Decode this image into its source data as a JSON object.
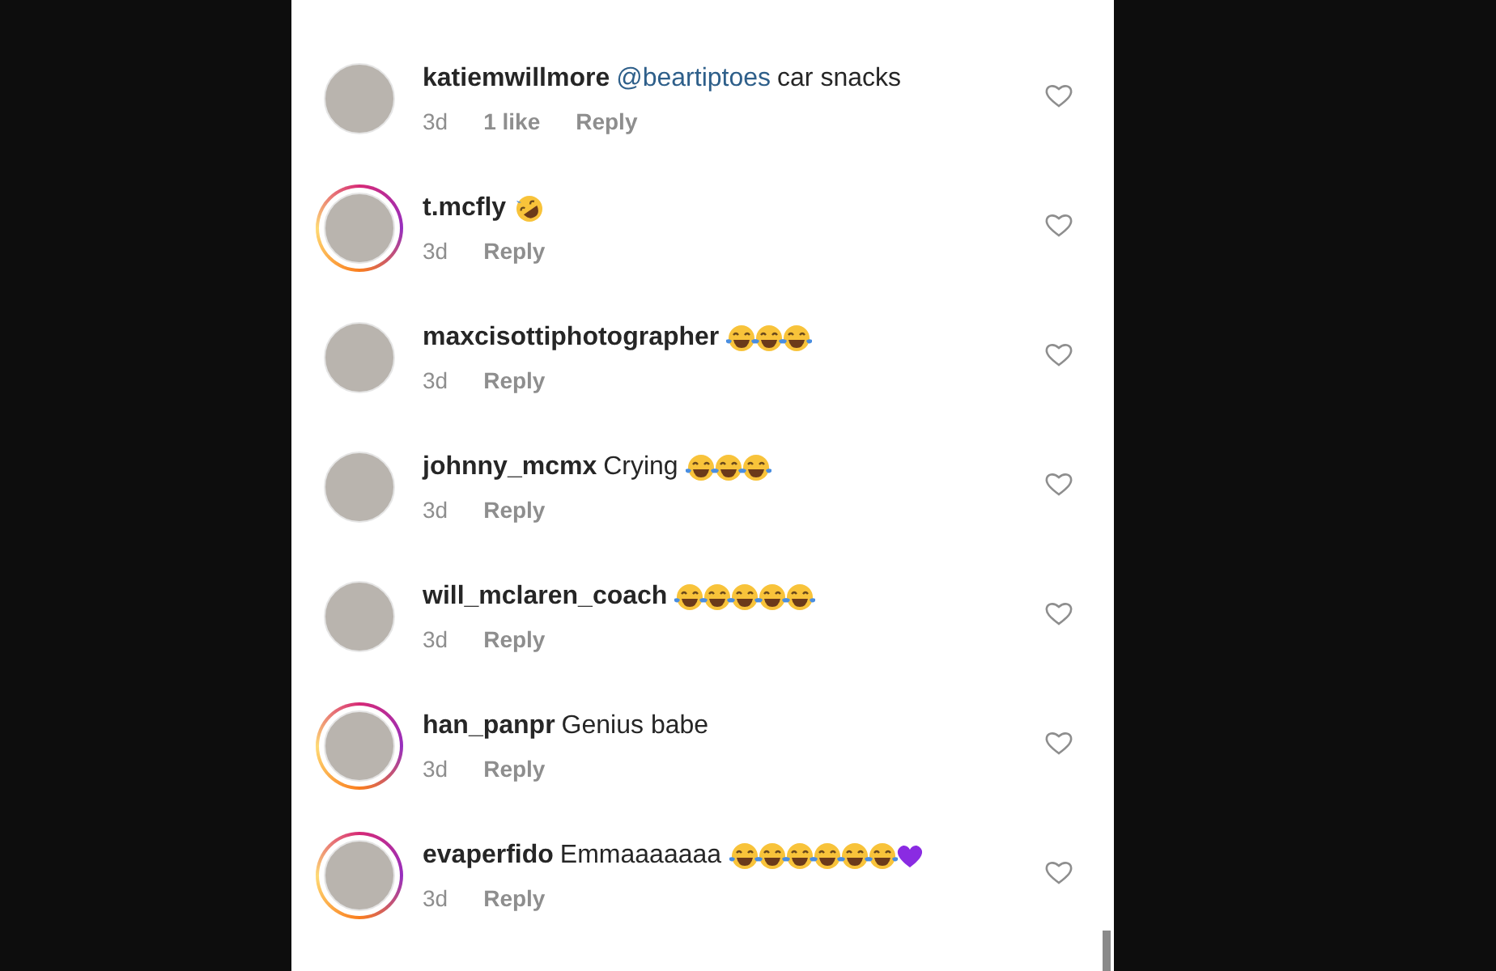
{
  "comments": [
    {
      "username": "katiemwillmore",
      "mention": "@beartiptoes",
      "text": "car snacks",
      "story_ring": false,
      "time": "3d",
      "likes": "1 like",
      "reply": "Reply"
    },
    {
      "username": "t.mcfly",
      "emoji": [
        {
          "kind": "rolling-laugh"
        }
      ],
      "story_ring": true,
      "time": "3d",
      "reply": "Reply"
    },
    {
      "username": "maxcisottiphotographer",
      "emoji": [
        {
          "kind": "tears-of-joy"
        },
        {
          "kind": "tears-of-joy"
        },
        {
          "kind": "tears-of-joy"
        }
      ],
      "story_ring": false,
      "time": "3d",
      "reply": "Reply"
    },
    {
      "username": "johnny_mcmx",
      "text": "Crying",
      "emoji": [
        {
          "kind": "tears-of-joy"
        },
        {
          "kind": "tears-of-joy"
        },
        {
          "kind": "tears-of-joy"
        }
      ],
      "story_ring": false,
      "time": "3d",
      "reply": "Reply"
    },
    {
      "username": "will_mclaren_coach",
      "emoji": [
        {
          "kind": "tears-of-joy"
        },
        {
          "kind": "tears-of-joy"
        },
        {
          "kind": "tears-of-joy"
        },
        {
          "kind": "tears-of-joy"
        },
        {
          "kind": "tears-of-joy"
        }
      ],
      "story_ring": false,
      "time": "3d",
      "reply": "Reply"
    },
    {
      "username": "han_panpr",
      "text": "Genius babe",
      "story_ring": true,
      "time": "3d",
      "reply": "Reply"
    },
    {
      "username": "evaperfido",
      "text": "Emmaaaaaaa",
      "emoji": [
        {
          "kind": "tears-of-joy"
        },
        {
          "kind": "tears-of-joy"
        },
        {
          "kind": "tears-of-joy"
        },
        {
          "kind": "tears-of-joy"
        },
        {
          "kind": "tears-of-joy"
        },
        {
          "kind": "tears-of-joy"
        },
        {
          "kind": "purple-heart"
        }
      ],
      "story_ring": true,
      "time": "3d",
      "reply": "Reply"
    }
  ]
}
